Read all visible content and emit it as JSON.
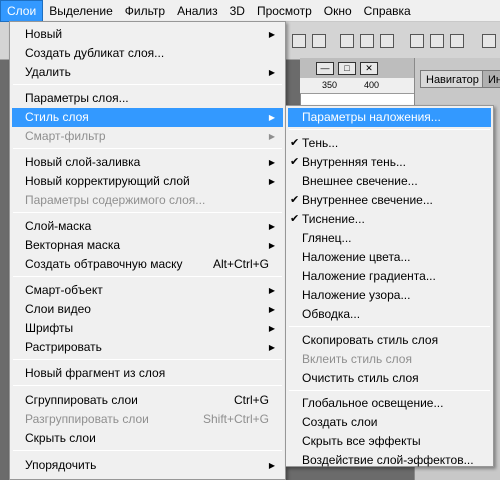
{
  "menubar": [
    "Слои",
    "Выделение",
    "Фильтр",
    "Анализ",
    "3D",
    "Просмотр",
    "Окно",
    "Справка"
  ],
  "background": {
    "ruler_marks": [
      "350",
      "400"
    ],
    "panel_tabs": [
      "Навигатор",
      "Ин"
    ]
  },
  "layers_menu": {
    "items": [
      {
        "label": "Новый",
        "arrow": true
      },
      {
        "label": "Создать дубликат слоя..."
      },
      {
        "label": "Удалить",
        "arrow": true
      },
      {
        "label": "Параметры слоя..."
      },
      {
        "label": "Стиль слоя",
        "arrow": true,
        "highlighted": true
      },
      {
        "label": "Смарт-фильтр",
        "arrow": true,
        "disabled": true
      },
      {
        "label": "Новый слой-заливка",
        "arrow": true
      },
      {
        "label": "Новый корректирующий слой",
        "arrow": true
      },
      {
        "label": "Параметры содержимого слоя...",
        "disabled": true
      },
      {
        "label": "Слой-маска",
        "arrow": true
      },
      {
        "label": "Векторная маска",
        "arrow": true
      },
      {
        "label": "Создать обтравочную маску",
        "shortcut": "Alt+Ctrl+G"
      },
      {
        "label": "Смарт-объект",
        "arrow": true
      },
      {
        "label": "Слои видео",
        "arrow": true
      },
      {
        "label": "Шрифты",
        "arrow": true
      },
      {
        "label": "Растрировать",
        "arrow": true
      },
      {
        "label": "Новый фрагмент из слоя"
      },
      {
        "label": "Сгруппировать слои",
        "shortcut": "Ctrl+G"
      },
      {
        "label": "Разгруппировать слои",
        "shortcut": "Shift+Ctrl+G",
        "disabled": true
      },
      {
        "label": "Скрыть слои"
      },
      {
        "label": "Упорядочить",
        "arrow": true
      }
    ]
  },
  "style_submenu": {
    "items": [
      {
        "label": "Параметры наложения...",
        "highlighted": true
      },
      {
        "label": "Тень...",
        "checked": true
      },
      {
        "label": "Внутренняя тень...",
        "checked": true
      },
      {
        "label": "Внешнее свечение..."
      },
      {
        "label": "Внутреннее свечение...",
        "checked": true
      },
      {
        "label": "Тиснение...",
        "checked": true
      },
      {
        "label": "Глянец..."
      },
      {
        "label": "Наложение цвета..."
      },
      {
        "label": "Наложение градиента..."
      },
      {
        "label": "Наложение узора..."
      },
      {
        "label": "Обводка..."
      },
      {
        "label": "Скопировать стиль слоя"
      },
      {
        "label": "Вклеить стиль слоя",
        "disabled": true
      },
      {
        "label": "Очистить стиль слоя"
      },
      {
        "label": "Глобальное освещение..."
      },
      {
        "label": "Создать слои"
      },
      {
        "label": "Скрыть все эффекты"
      },
      {
        "label": "Воздействие слой-эффектов..."
      }
    ]
  },
  "colors": {
    "highlight": "#3399ff",
    "menu_bg": "#f0f0f0",
    "disabled_text": "#8f8f8f"
  }
}
